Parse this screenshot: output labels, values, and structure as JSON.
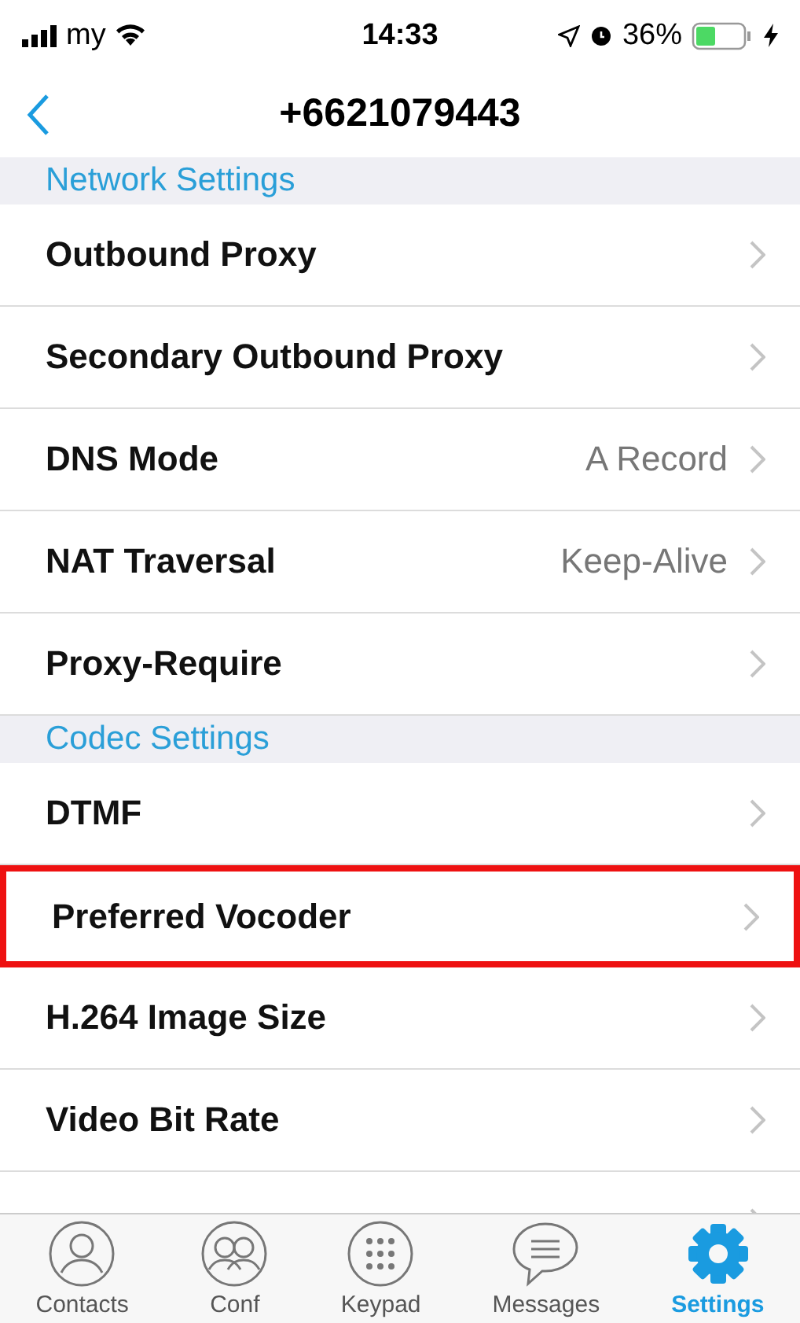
{
  "status_bar": {
    "carrier": "my",
    "time": "14:33",
    "battery": "36%"
  },
  "nav": {
    "title": "+6621079443"
  },
  "sections": [
    {
      "header": "Network Settings",
      "rows": [
        {
          "label": "Outbound Proxy",
          "highlighted": false
        },
        {
          "label": "Secondary Outbound Proxy",
          "highlighted": false
        },
        {
          "label": "DNS Mode",
          "value": "A Record",
          "highlighted": false
        },
        {
          "label": "NAT Traversal",
          "value": "Keep-Alive",
          "highlighted": false
        },
        {
          "label": "Proxy-Require",
          "highlighted": false
        }
      ]
    },
    {
      "header": "Codec Settings",
      "rows": [
        {
          "label": "DTMF",
          "highlighted": false
        },
        {
          "label": "Preferred Vocoder",
          "highlighted": true
        },
        {
          "label": "H.264 Image Size",
          "highlighted": false
        },
        {
          "label": "Video Bit Rate",
          "highlighted": false
        },
        {
          "highlighted": false
        }
      ]
    }
  ],
  "tab_bar": [
    {
      "kind": "contacts",
      "label": "Contacts",
      "selected": false
    },
    {
      "kind": "conf",
      "label": "Conf",
      "selected": false
    },
    {
      "kind": "keypad",
      "label": "Keypad",
      "selected": false
    },
    {
      "kind": "messages",
      "label": "Messages",
      "selected": false
    },
    {
      "kind": "settings",
      "label": "Settings",
      "selected": true
    }
  ]
}
